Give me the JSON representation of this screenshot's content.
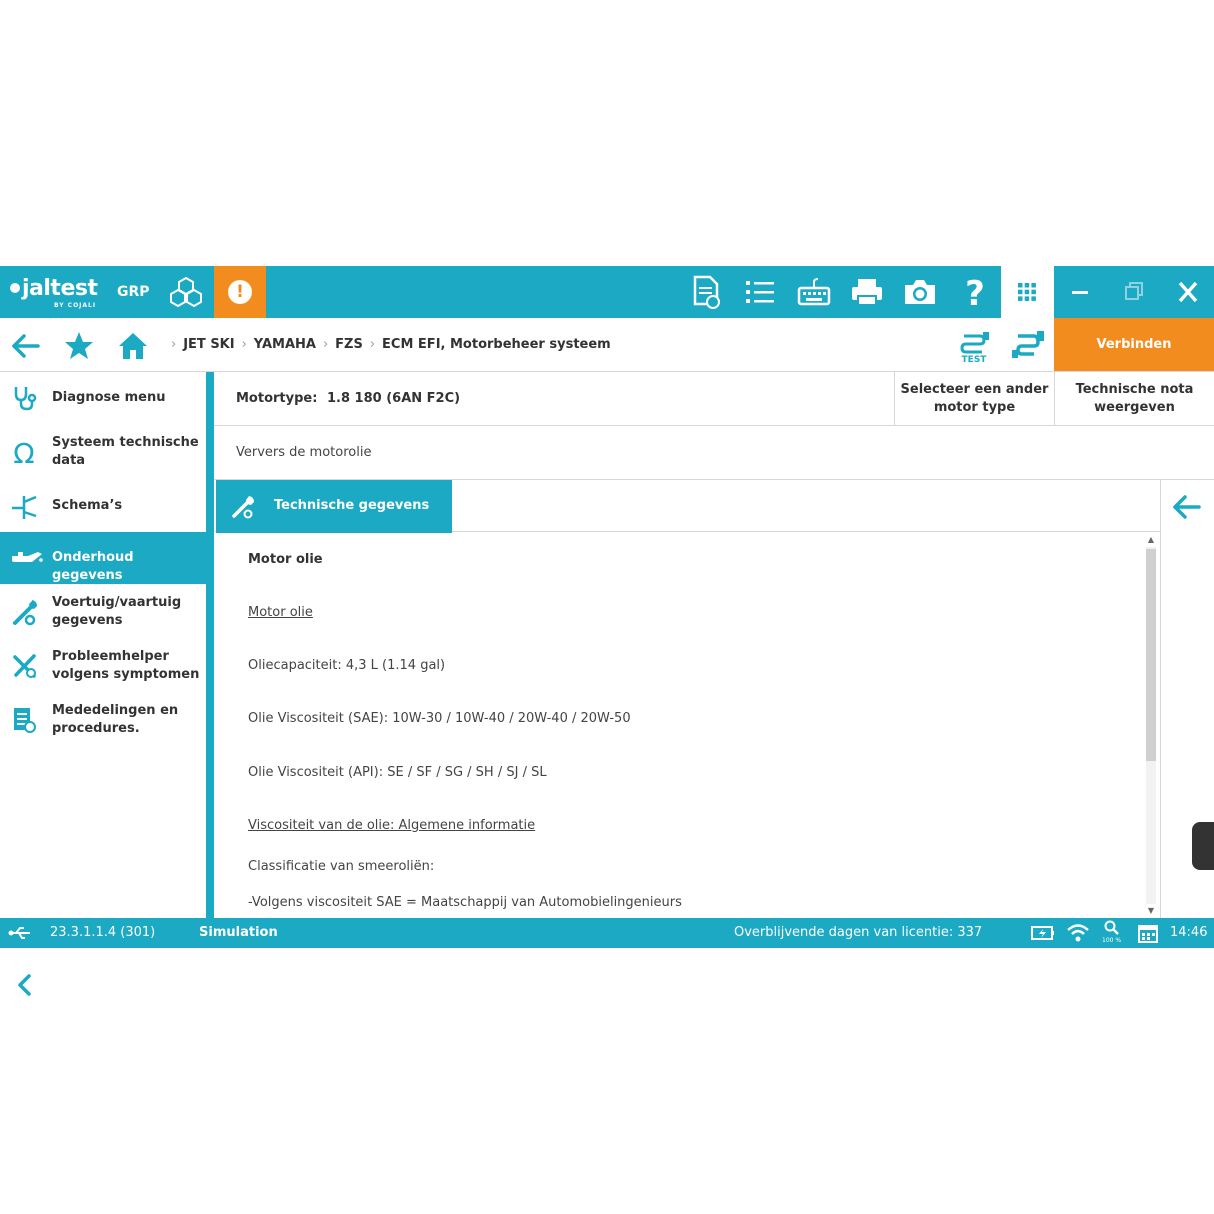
{
  "topbar": {
    "logo_text": "jaltest",
    "logo_sub": "BY COJALI",
    "grp_label": "GRP",
    "alert_symbol": "!",
    "icons": [
      "report-icon",
      "list-icon",
      "keyboard-icon",
      "printer-icon",
      "camera-icon",
      "help-icon",
      "apps-grid-icon"
    ],
    "window_controls": [
      "minimize-icon",
      "restore-icon",
      "close-icon"
    ]
  },
  "navbar": {
    "breadcrumbs": [
      "JET SKI",
      "YAMAHA",
      "FZS",
      "ECM EFI, Motorbeheer systeem"
    ],
    "test_label": "TEST",
    "connect_label": "Verbinden"
  },
  "sidebar": {
    "items": [
      {
        "label": "Diagnose menu",
        "icon": "stethoscope-icon"
      },
      {
        "label": "Systeem technische data",
        "icon": "omega-icon"
      },
      {
        "label": "Schema’s",
        "icon": "schematic-icon"
      },
      {
        "label": "Onderhoud gegevens",
        "icon": "oil-can-icon",
        "active": true
      },
      {
        "label": "Voertuig/vaartuig gegevens",
        "icon": "wrench-gear-icon"
      },
      {
        "label": "Probleemhelper volgens symptomen",
        "icon": "tools-icon"
      },
      {
        "label": "Mededelingen en procedures.",
        "icon": "documents-icon"
      }
    ]
  },
  "main": {
    "motor_label": "Motortype:",
    "motor_value": "1.8 180 (6AN F2C)",
    "select_motor_button": "Selecteer een ander motor type",
    "tech_note_button": "Technische nota weergeven",
    "sub_title": "Ververs de motorolie",
    "tab_label": "Technische gegevens",
    "lines": [
      {
        "text": "Motor olie",
        "style": "bold"
      },
      {
        "text": "Motor olie",
        "style": "link"
      },
      {
        "text": "Oliecapaciteit: 4,3 L (1.14 gal)",
        "style": "normal"
      },
      {
        "text": "Olie Viscositeit (SAE): 10W-30 / 10W-40 / 20W-40 / 20W-50",
        "style": "normal"
      },
      {
        "text": "Olie Viscositeit (API): SE / SF / SG / SH / SJ / SL",
        "style": "normal"
      },
      {
        "text": "Viscositeit van de olie: Algemene informatie",
        "style": "link"
      },
      {
        "text": "Classificatie van smeeroliën:",
        "style": "normal"
      },
      {
        "text": "-Volgens viscositeit SAE = Maatschappij van Automobielingenieurs",
        "style": "normal"
      }
    ]
  },
  "status": {
    "version": "23.3.1.1.4 (301)",
    "mode": "Simulation",
    "license": "Overblijvende dagen van licentie: 337",
    "zoom": "100 %",
    "time": "14:46"
  },
  "colors": {
    "accent": "#1ba9c3",
    "orange": "#f28c1e"
  }
}
